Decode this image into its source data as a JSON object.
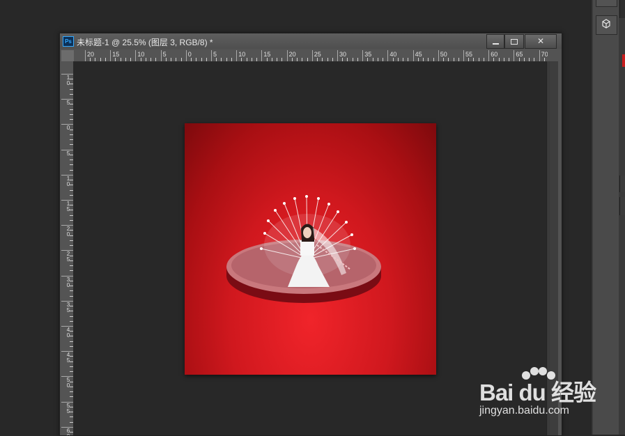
{
  "document_window": {
    "app_icon": "Ps",
    "title": "未标题-1 @ 25.5% (图层 3, RGB/8) *",
    "controls": {
      "minimize": "minimize-icon",
      "maximize": "maximize-icon",
      "close": "close-icon"
    }
  },
  "ruler_horizontal": {
    "labels": [
      "20",
      "15",
      "10",
      "5",
      "0",
      "5",
      "10",
      "15",
      "20",
      "25",
      "30",
      "35",
      "40",
      "45",
      "50",
      "55",
      "60",
      "65",
      "70"
    ]
  },
  "ruler_vertical": {
    "labels": [
      "10",
      "5",
      "0",
      "5",
      "10",
      "15",
      "20",
      "25",
      "30",
      "35",
      "40",
      "45",
      "50",
      "55",
      "60"
    ]
  },
  "canvas": {
    "zoom": "25.5%",
    "artwork_description_colors": {
      "background": "#d0181e",
      "platform": "#b8646b"
    }
  },
  "right_dock": {
    "icons": [
      "cube-3d-icon"
    ]
  },
  "watermark": {
    "logo": "Bai du 经验",
    "url": "jingyan.baidu.com"
  }
}
